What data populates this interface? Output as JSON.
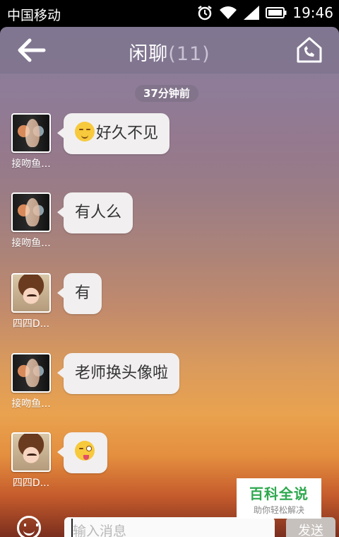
{
  "status_bar": {
    "carrier": "中国移动",
    "time": "19:46",
    "icons": [
      "alarm-icon",
      "wifi-icon",
      "signal-icon",
      "battery-icon"
    ]
  },
  "header": {
    "title": "闲聊",
    "member_count": "(11)",
    "back_icon": "back-arrow-icon",
    "home_icon": "house-phone-icon"
  },
  "chat": {
    "timestamp": "37分钟前",
    "messages": [
      {
        "sender": "接吻鱼...",
        "avatar": "kissing-couple",
        "emoji": "relieved-face",
        "text": "好久不见"
      },
      {
        "sender": "接吻鱼...",
        "avatar": "kissing-couple",
        "text": "有人么"
      },
      {
        "sender": "四四D...",
        "avatar": "little-girl",
        "text": "有"
      },
      {
        "sender": "接吻鱼...",
        "avatar": "kissing-couple",
        "text": "老师换头像啦"
      },
      {
        "sender": "四四D...",
        "avatar": "little-girl",
        "emoji": "winking-tongue-face",
        "text": ""
      }
    ]
  },
  "input_bar": {
    "placeholder": "输入消息",
    "send_label": "发送",
    "emoji_icon": "smiley-icon"
  },
  "watermark": {
    "title": "百科全说",
    "subtitle": "助你轻松解决"
  },
  "colors": {
    "bubble": "#f1efef",
    "watermark_green": "#2fa84f"
  }
}
